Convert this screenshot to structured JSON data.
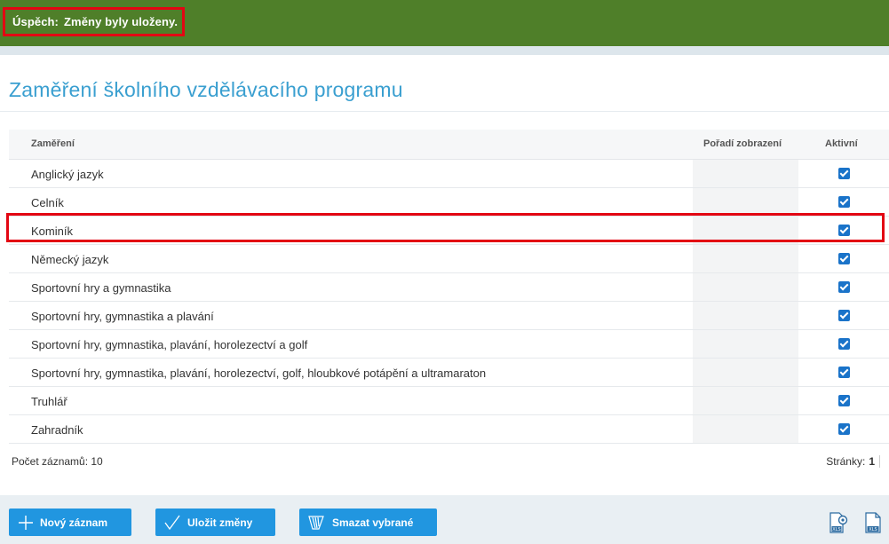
{
  "banner": {
    "label": "Úspěch:",
    "message": "Změny byly uloženy."
  },
  "page": {
    "title": "Zaměření školního vzdělávacího programu"
  },
  "grid": {
    "columns": {
      "name": "Zaměření",
      "order": "Pořadí zobrazení",
      "active": "Aktivní"
    },
    "rows": [
      {
        "name": "Anglický jazyk",
        "active": true
      },
      {
        "name": "Celník",
        "active": true
      },
      {
        "name": "Kominík",
        "active": true
      },
      {
        "name": "Německý jazyk",
        "active": true
      },
      {
        "name": "Sportovní hry a gymnastika",
        "active": true
      },
      {
        "name": "Sportovní hry, gymnastika a plavání",
        "active": true
      },
      {
        "name": "Sportovní hry, gymnastika, plavání, horolezectví a golf",
        "active": true
      },
      {
        "name": "Sportovní hry, gymnastika, plavání, horolezectví, golf, hloubkové potápění a ultramaraton",
        "active": true
      },
      {
        "name": "Truhlář",
        "active": true
      },
      {
        "name": "Zahradník",
        "active": true
      }
    ],
    "record_count": "Počet záznamů: 10",
    "pages_label": "Stránky:",
    "page_number": "1"
  },
  "actions": {
    "new_record": "Nový záznam",
    "save_changes": "Uložit změny",
    "delete_selected": "Smazat vybrané"
  },
  "icons": {
    "new_record": "plus-icon",
    "save_changes": "checkmark-icon",
    "delete_selected": "eraser-icon",
    "xls_settings": "xls-settings-icon",
    "xls_export": "xls-export-icon"
  },
  "colors": {
    "success_banner": "#4f7f29",
    "highlight": "#e30613",
    "title": "#3a9fd0",
    "button": "#2196e0",
    "checkbox": "#1a73c9"
  }
}
